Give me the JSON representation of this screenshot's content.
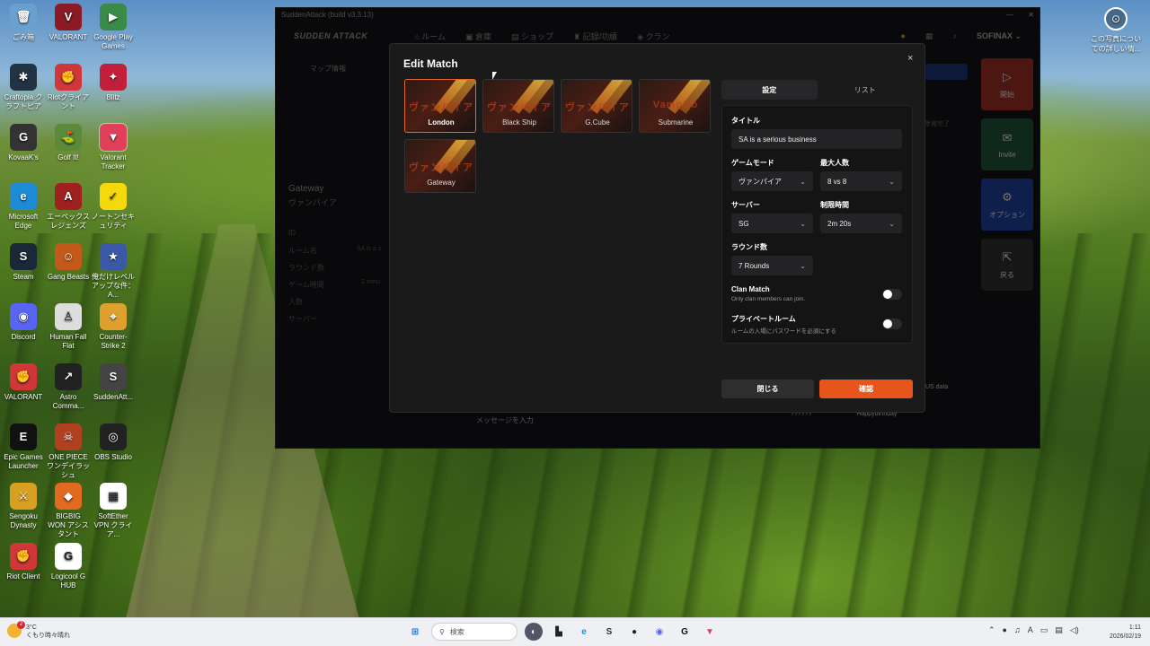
{
  "desktop": {
    "icons": [
      {
        "label": "ごみ箱",
        "glyph": "🗑",
        "bg": "#6aa0d0"
      },
      {
        "label": "VALORANT",
        "glyph": "V",
        "bg": "#8b1a24"
      },
      {
        "label": "Google Play Games",
        "glyph": "▶",
        "bg": "#3a8a4a"
      },
      {
        "label": "Craftopia クラフトピア",
        "glyph": "✱",
        "bg": "#223344"
      },
      {
        "label": "Riotクライアント",
        "glyph": "✊",
        "bg": "#d13639"
      },
      {
        "label": "Blitz",
        "glyph": "✦",
        "bg": "#c2203a"
      },
      {
        "label": "KovaaK's",
        "glyph": "G",
        "bg": "#333"
      },
      {
        "label": "Golf It!",
        "glyph": "⛳",
        "bg": "#5b8a3a"
      },
      {
        "label": "Valorant Tracker",
        "glyph": "▼",
        "bg": "#e0405a"
      },
      {
        "label": "Microsoft Edge",
        "glyph": "e",
        "bg": "#1d8bd6"
      },
      {
        "label": "エーペックスレジェンズ",
        "glyph": "A",
        "bg": "#a02020"
      },
      {
        "label": "ノートンセキュリティ",
        "glyph": "✓",
        "bg": "#f5d90a"
      },
      {
        "label": "Steam",
        "glyph": "S",
        "bg": "#1b2838"
      },
      {
        "label": "Gang Beasts",
        "glyph": "☺",
        "bg": "#c45a1a"
      },
      {
        "label": "俺だけレベルアップな件：A...",
        "glyph": "★",
        "bg": "#3a5aa8"
      },
      {
        "label": "Discord",
        "glyph": "◉",
        "bg": "#5865f2"
      },
      {
        "label": "Human Fall Flat",
        "glyph": "♙",
        "bg": "#ddd"
      },
      {
        "label": "Counter-Strike 2",
        "glyph": "⌖",
        "bg": "#e0a030"
      },
      {
        "label": "VALORANT",
        "glyph": "✊",
        "bg": "#d13639"
      },
      {
        "label": "Astro Comma...",
        "glyph": "↗",
        "bg": "#222"
      },
      {
        "label": "SuddenAtt...",
        "glyph": "S",
        "bg": "#444"
      },
      {
        "label": "Epic Games Launcher",
        "glyph": "E",
        "bg": "#111"
      },
      {
        "label": "ONE PIECE ワンデイラッシュ",
        "glyph": "☠",
        "bg": "#b04020"
      },
      {
        "label": "OBS Studio",
        "glyph": "◎",
        "bg": "#222"
      },
      {
        "label": "Sengoku Dynasty",
        "glyph": "⚔",
        "bg": "#d8a020"
      },
      {
        "label": "BIGBIG WON アシスタント",
        "glyph": "◆",
        "bg": "#e06a20"
      },
      {
        "label": "SoftEther VPN クライア...",
        "glyph": "▦",
        "bg": "#fff"
      },
      {
        "label": "Riot Client",
        "glyph": "✊",
        "bg": "#d13639"
      },
      {
        "label": "Logicool G HUB",
        "glyph": "G",
        "bg": "#fff"
      }
    ],
    "right_icon": {
      "label": "この写真についての詳しい情...",
      "glyph": "⊙"
    }
  },
  "app": {
    "title": "SuddenAttack (build v3.3.13)",
    "logo": "SUDDEN ATTACK",
    "nav": [
      "ルーム",
      "倉庫",
      "ショップ",
      "記録/功績",
      "クラン"
    ],
    "user": "SOFINAX",
    "bg_left": {
      "map_info": "マップ情報",
      "map_name": "Gateway",
      "mode": "ヴァンパイア",
      "rows": [
        "ID",
        "ルーム名",
        "ラウンド数",
        "ゲーム時間",
        "人数",
        "サーバー"
      ],
      "val_room": "SA is a s",
      "val_time": "2 minu"
    },
    "right_buttons": [
      {
        "label": "開始",
        "glyph": "▷",
        "bg": "#8a2a20"
      },
      {
        "label": "Invite",
        "glyph": "✉",
        "bg": "#1e4a32"
      },
      {
        "label": "オプション",
        "glyph": "⚙",
        "bg": "#1d3a8a"
      },
      {
        "label": "戻る",
        "glyph": "⇱",
        "bg": "#2a2a2c"
      }
    ],
    "bg_ready": "準備完了",
    "bg_message_placeholder": "メッセージを入力",
    "bg_chat_user": "??????",
    "bg_chat_msg": "Happybirthday",
    "bg_chat_tail": "US data"
  },
  "modal": {
    "title": "Edit Match",
    "close_glyph": "×",
    "maps": [
      {
        "name": "London",
        "watermark": "ヴァンパイア",
        "selected": true
      },
      {
        "name": "Black Ship",
        "watermark": "ヴァンパイア",
        "selected": false
      },
      {
        "name": "G.Cube",
        "watermark": "ヴァンパイア",
        "selected": false
      },
      {
        "name": "Submarine",
        "watermark": "Vampiro",
        "selected": false
      },
      {
        "name": "Gateway",
        "watermark": "ヴァンパイア",
        "selected": false
      }
    ],
    "tabs": [
      {
        "label": "設定",
        "active": true
      },
      {
        "label": "リスト",
        "active": false
      }
    ],
    "form": {
      "title_label": "タイトル",
      "title_value": "SA is a serious business",
      "mode_label": "ゲームモード",
      "mode_value": "ヴァンパイア",
      "max_label": "最大人数",
      "max_value": "8 vs 8",
      "server_label": "サーバー",
      "server_value": "SG",
      "time_label": "制限時間",
      "time_value": "2m 20s",
      "rounds_label": "ラウンド数",
      "rounds_value": "7 Rounds",
      "clan_label": "Clan Match",
      "clan_desc": "Only clan members can join.",
      "clan_on": false,
      "private_label": "プライベートルーム",
      "private_desc": "ルームの入場にパスワードを必須にする",
      "private_on": false
    },
    "close_button": "閉じる",
    "confirm_button": "確認",
    "accent": "#e8551c"
  },
  "taskbar": {
    "weather_temp": "3°C",
    "weather_desc": "くもり時々晴れ",
    "weather_badge": "2",
    "search_placeholder": "検索",
    "time": "1:11",
    "date": "2026/02/19",
    "tray_ime": "A"
  }
}
